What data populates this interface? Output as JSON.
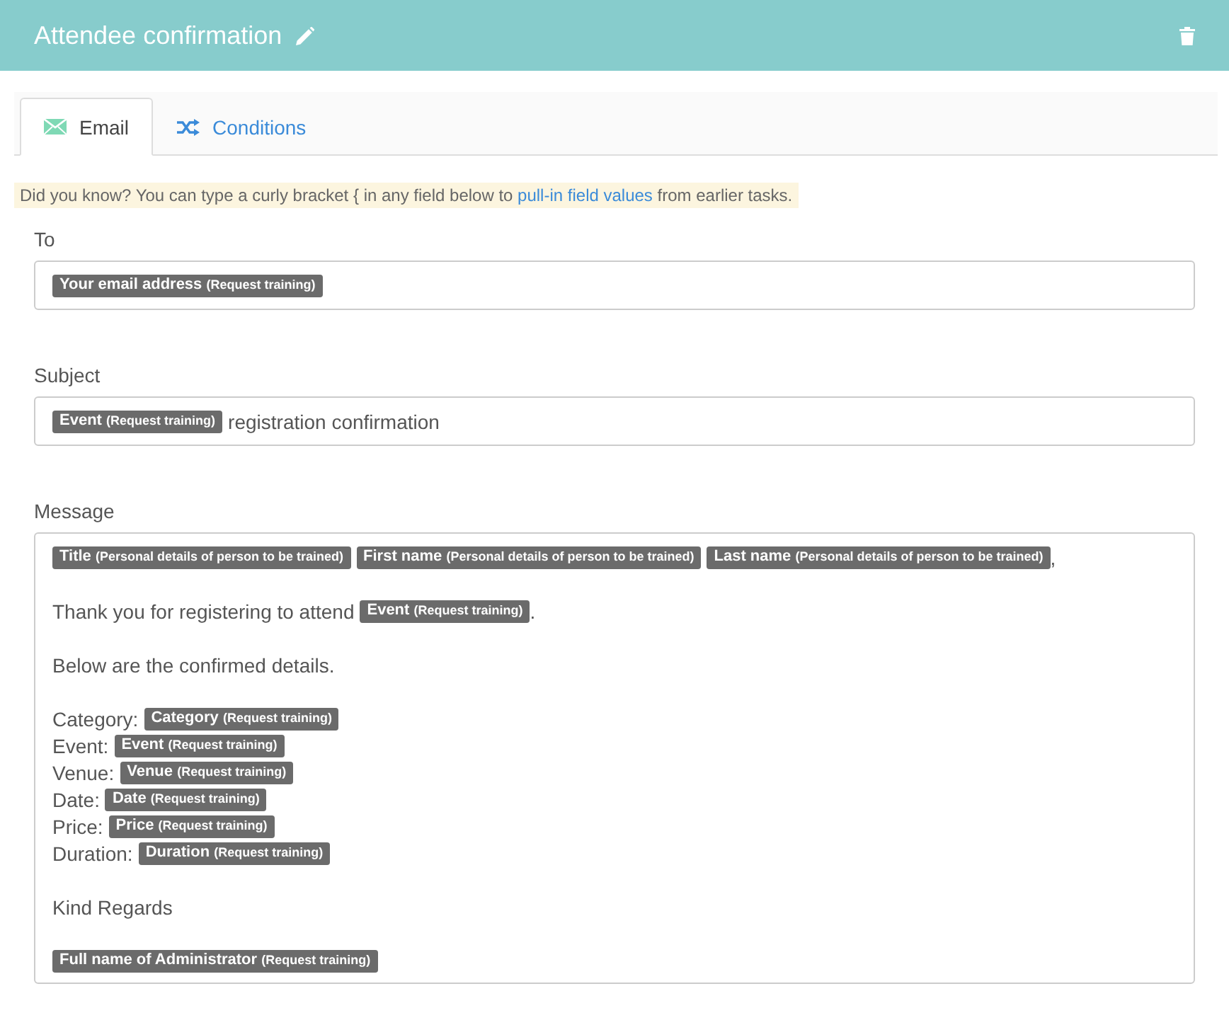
{
  "header": {
    "title": "Attendee confirmation"
  },
  "tabs": [
    {
      "label": "Email",
      "selected": true
    },
    {
      "label": "Conditions",
      "selected": false
    }
  ],
  "hint": {
    "before": "Did you know? You can type a curly bracket { in any field below to ",
    "link": "pull-in field values",
    "after": " from earlier tasks."
  },
  "fields": [
    {
      "label": "To",
      "kind": "single",
      "segments": [
        {
          "kind": "token",
          "name": "Your email address",
          "source": "(Request training)"
        }
      ]
    },
    {
      "label": "Subject",
      "kind": "single",
      "segments": [
        {
          "kind": "token",
          "name": "Event",
          "source": "(Request training)"
        },
        {
          "kind": "text",
          "text": "registration confirmation"
        }
      ]
    },
    {
      "label": "Message",
      "kind": "multi",
      "paragraphs": [
        [
          [
            {
              "kind": "token",
              "name": "Title",
              "source": "(Personal details of person to be trained)"
            },
            {
              "kind": "token",
              "name": "First name",
              "source": "(Personal details of person to be trained)"
            },
            {
              "kind": "token",
              "name": "Last name",
              "source": "(Personal details of person to be trained)"
            },
            {
              "kind": "punct",
              "text": ","
            }
          ]
        ],
        [
          [
            {
              "kind": "text",
              "text": "Thank you for registering to attend"
            },
            {
              "kind": "token",
              "name": "Event",
              "source": "(Request training)"
            },
            {
              "kind": "punct",
              "text": "."
            }
          ]
        ],
        [
          [
            {
              "kind": "text",
              "text": "Below are the confirmed details."
            }
          ]
        ],
        [
          [
            {
              "kind": "text",
              "text": "Category:"
            },
            {
              "kind": "token",
              "name": "Category",
              "source": "(Request training)"
            }
          ],
          [
            {
              "kind": "text",
              "text": "Event:"
            },
            {
              "kind": "token",
              "name": "Event",
              "source": "(Request training)"
            }
          ],
          [
            {
              "kind": "text",
              "text": "Venue:"
            },
            {
              "kind": "token",
              "name": "Venue",
              "source": "(Request training)"
            }
          ],
          [
            {
              "kind": "text",
              "text": "Date:"
            },
            {
              "kind": "token",
              "name": "Date",
              "source": "(Request training)"
            }
          ],
          [
            {
              "kind": "text",
              "text": "Price:"
            },
            {
              "kind": "token",
              "name": "Price",
              "source": "(Request training)"
            }
          ],
          [
            {
              "kind": "text",
              "text": "Duration:"
            },
            {
              "kind": "token",
              "name": "Duration",
              "source": "(Request training)"
            }
          ]
        ],
        [
          [
            {
              "kind": "text",
              "text": "Kind Regards"
            }
          ]
        ],
        [
          [
            {
              "kind": "token",
              "name": "Full name of Administrator",
              "source": "(Request training)"
            }
          ]
        ]
      ]
    }
  ]
}
